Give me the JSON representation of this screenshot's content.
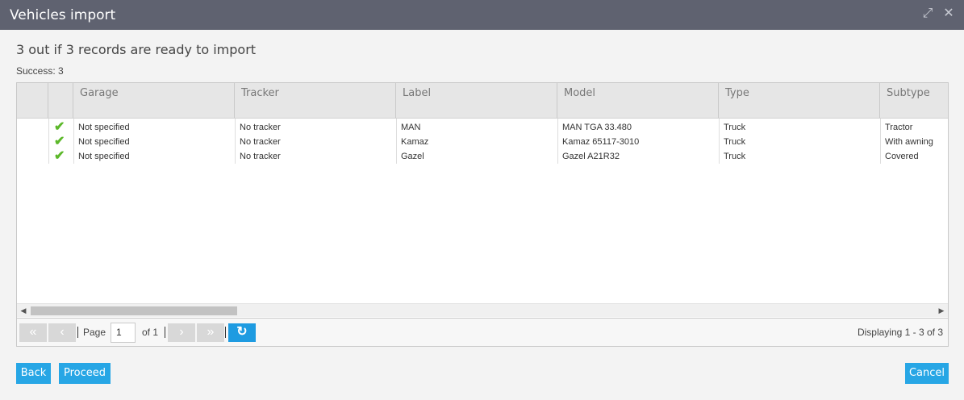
{
  "window": {
    "title": "Vehicles import"
  },
  "summary": "3 out if 3 records are ready to import",
  "success_text": "Success: 3",
  "columns": [
    "Garage",
    "Tracker",
    "Label",
    "Model",
    "Type",
    "Subtype"
  ],
  "rows": [
    {
      "status": "ok",
      "garage": "Not specified",
      "tracker": "No tracker",
      "label": "MAN",
      "model": "MAN TGA 33.480",
      "type": "Truck",
      "subtype": "Tractor"
    },
    {
      "status": "ok",
      "garage": "Not specified",
      "tracker": "No tracker",
      "label": "Kamaz",
      "model": "Kamaz 65117-3010",
      "type": "Truck",
      "subtype": "With awning"
    },
    {
      "status": "ok",
      "garage": "Not specified",
      "tracker": "No tracker",
      "label": "Gazel",
      "model": "Gazel A21R32",
      "type": "Truck",
      "subtype": "Covered"
    }
  ],
  "pager": {
    "page_label": "Page",
    "page_value": "1",
    "of_label": "of 1",
    "displaying": "Displaying 1 - 3 of 3"
  },
  "buttons": {
    "back": "Back",
    "proceed": "Proceed",
    "cancel": "Cancel"
  },
  "icons": {
    "maximize": "maximize-icon",
    "close": "close-icon",
    "check": "check-icon",
    "refresh": "refresh-icon"
  },
  "colors": {
    "accent": "#27a6e5",
    "titlebar": "#5f6270",
    "check": "#5cb82a"
  }
}
